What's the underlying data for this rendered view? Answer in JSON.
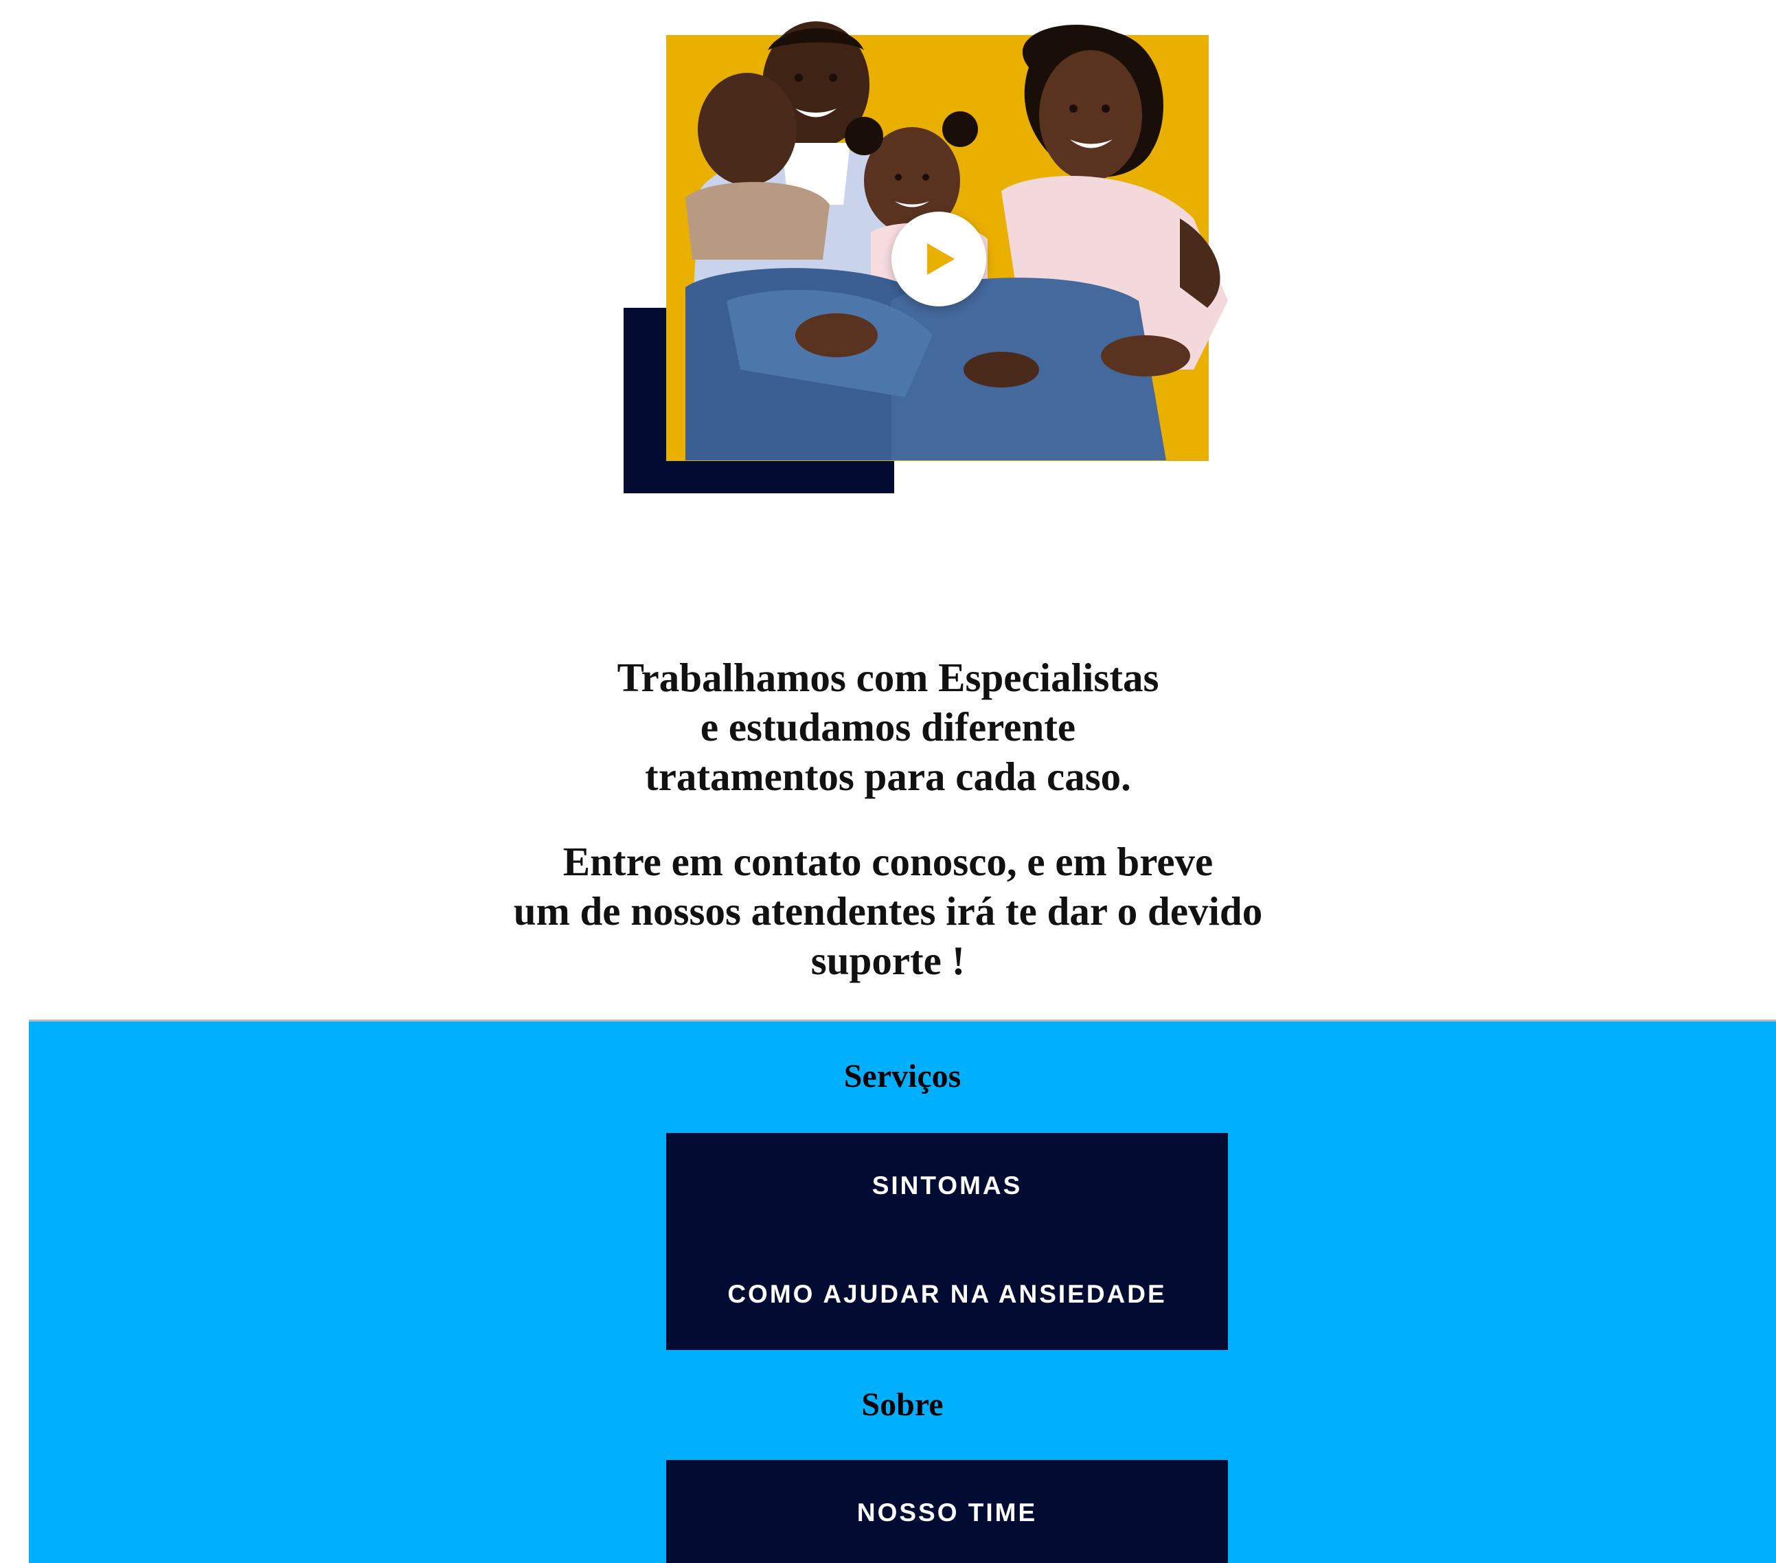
{
  "hero": {
    "image_description": "family-photo",
    "play_icon": "play-icon"
  },
  "message": {
    "line_1": "Trabalhamos com Especialistas",
    "line_2": "e estudamos diferente",
    "line_3": "tratamentos para cada caso.",
    "line_4": "Entre em contato conosco, e em breve",
    "line_5": "um de nossos atendentes irá te dar o devido",
    "line_6": "suporte !"
  },
  "footer": {
    "services_title": "Serviços",
    "services_links": [
      "SINTOMAS",
      "COMO AJUDAR NA ANSIEDADE"
    ],
    "about_title": "Sobre",
    "about_links": [
      "NOSSO TIME"
    ]
  },
  "colors": {
    "footer_bg": "#00b0ff",
    "menu_bg": "#020b31",
    "accent_yellow": "#e9b000"
  }
}
